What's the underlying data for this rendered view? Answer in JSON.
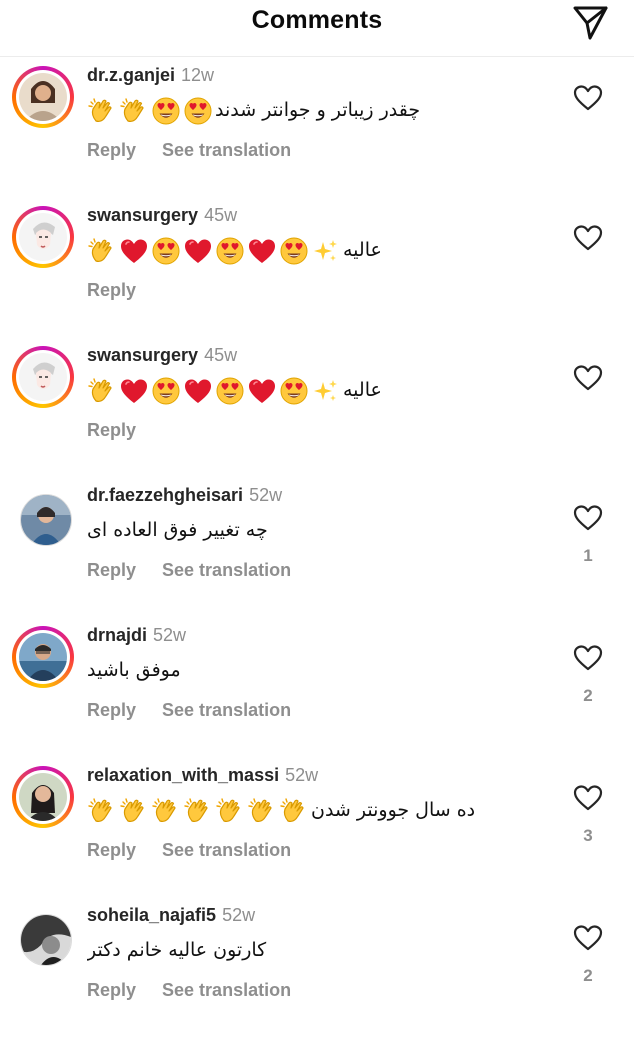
{
  "header": {
    "title": "Comments",
    "share_icon": "paper-plane-icon"
  },
  "colors": {
    "story_ring": [
      "#c913b9",
      "#f9373f",
      "#fec600"
    ],
    "muted": "#8e8e8e",
    "heart_red": "#e0182d",
    "emoji_yellow": "#ffc83d"
  },
  "comments": [
    {
      "username": "dr.z.ganjei",
      "time": "12w",
      "text": "چقدر زیباتر و جوانتر شدند",
      "emojis": [
        "clap",
        "clap",
        "heart-eyes",
        "heart-eyes"
      ],
      "reply_label": "Reply",
      "translate_label": "See translation",
      "likes": "",
      "story_ring": true
    },
    {
      "username": "swansurgery",
      "time": "45w",
      "text": "عالیه",
      "emojis": [
        "clap",
        "red-heart",
        "heart-eyes",
        "red-heart",
        "heart-eyes",
        "red-heart",
        "heart-eyes",
        "sparkles"
      ],
      "reply_label": "Reply",
      "translate_label": "",
      "likes": "",
      "story_ring": true
    },
    {
      "username": "swansurgery",
      "time": "45w",
      "text": "عالیه",
      "emojis": [
        "clap",
        "red-heart",
        "heart-eyes",
        "red-heart",
        "heart-eyes",
        "red-heart",
        "heart-eyes",
        "sparkles"
      ],
      "reply_label": "Reply",
      "translate_label": "",
      "likes": "",
      "story_ring": true
    },
    {
      "username": "dr.faezzehgheisari",
      "time": "52w",
      "text": "چه تغییر فوق العاده ای",
      "emojis": [],
      "reply_label": "Reply",
      "translate_label": "See translation",
      "likes": "1",
      "story_ring": false
    },
    {
      "username": "drnajdi",
      "time": "52w",
      "text": "موفق باشید",
      "emojis": [],
      "reply_label": "Reply",
      "translate_label": "See translation",
      "likes": "2",
      "story_ring": true
    },
    {
      "username": "relaxation_with_massi",
      "time": "52w",
      "text": "ده سال جوونتر شدن",
      "emojis": [
        "clap",
        "clap",
        "clap",
        "clap",
        "clap",
        "clap",
        "clap"
      ],
      "reply_label": "Reply",
      "translate_label": "See translation",
      "likes": "3",
      "story_ring": true
    },
    {
      "username": "soheila_najafi5",
      "time": "52w",
      "text": "کارتون عالیه خانم دکتر",
      "emojis": [],
      "reply_label": "Reply",
      "translate_label": "See translation",
      "likes": "2",
      "story_ring": false
    }
  ]
}
